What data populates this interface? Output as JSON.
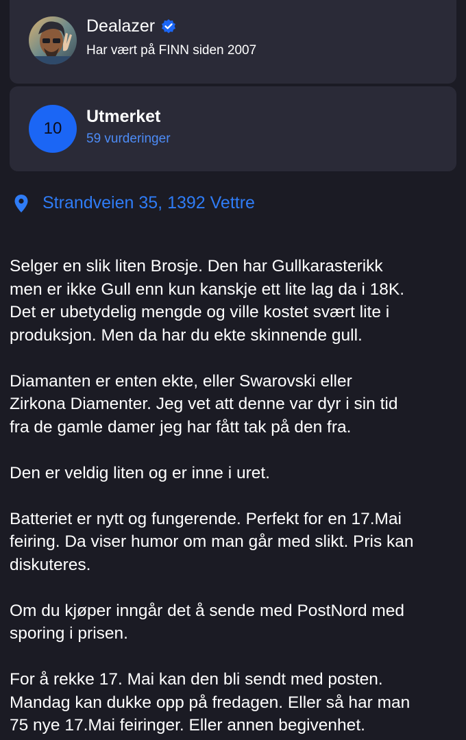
{
  "seller": {
    "name": "Dealazer",
    "since": "Har vært på FINN siden 2007",
    "verified_icon": "verified-badge-icon",
    "avatar_icon": "avatar-image"
  },
  "rating": {
    "score": "10",
    "label": "Utmerket",
    "count": "59 vurderinger"
  },
  "location": {
    "icon": "location-pin-icon",
    "address": "Strandveien 35, 1392 Vettre"
  },
  "description": {
    "paragraphs": [
      "Selger en slik liten Brosje. Den har Gullkarasterikk\nmen er ikke Gull enn kun kanskje ett lite lag da i 18K.\nDet er ubetydelig mengde og ville kostet svært lite i\nproduksjon. Men da har du ekte skinnende gull.",
      "Diamanten er enten ekte, eller Swarovski eller\nZirkona Diamenter. Jeg vet att denne var dyr i sin tid\nfra de gamle damer jeg har fått tak på den fra.",
      "Den er veldig liten og er inne i uret.",
      "Batteriet er nytt og fungerende. Perfekt for en 17.Mai\nfeiring. Da viser humor om man går med slikt. Pris kan\ndiskuteres.",
      "Om du kjøper inngår det å sende med PostNord med\nsporing i prisen.",
      "For å rekke 17. Mai kan den bli sendt med posten.\nMandag kan dukke opp på fredagen. Eller så har man\n75 nye 17.Mai feiringer. Eller annen begivenhet."
    ]
  },
  "colors": {
    "background": "#1b1b24",
    "card": "#2a2a37",
    "accent": "#1b66f5",
    "link": "#4d8cf7"
  }
}
